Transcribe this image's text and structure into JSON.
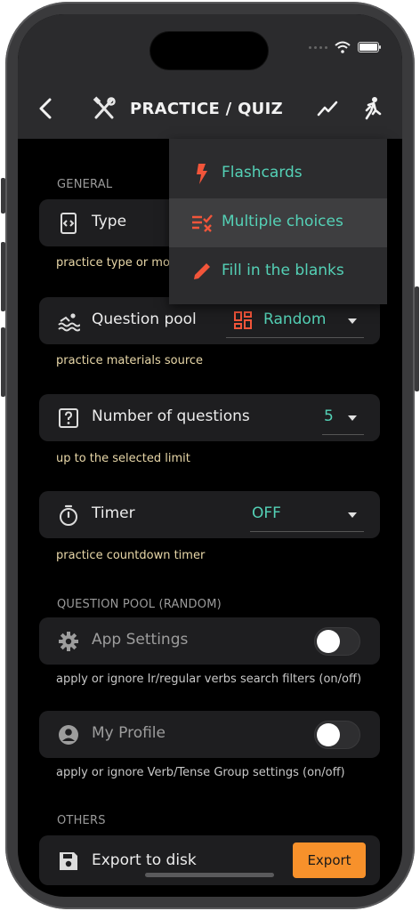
{
  "app_bar": {
    "title": "PRACTICE / QUIZ",
    "back_icon": "chevron-left-icon",
    "tools_icon": "tools-icon",
    "stats_icon": "trending-icon",
    "run_icon": "running-person-icon"
  },
  "dropdown_menu": {
    "items": [
      {
        "label": "Flashcards",
        "icon": "bolt-icon",
        "highlighted": false
      },
      {
        "label": "Multiple choices",
        "icon": "checklist-icon",
        "highlighted": true
      },
      {
        "label": "Fill in the blanks",
        "icon": "pencil-icon",
        "highlighted": false
      }
    ]
  },
  "sections": {
    "general": "GENERAL",
    "question_pool": "QUESTION POOL (RANDOM)",
    "others": "OTHERS"
  },
  "type_setting": {
    "label": "Type",
    "helper": "practice type or mo"
  },
  "question_pool_setting": {
    "label": "Question pool",
    "value": "Random",
    "helper": "practice materials source"
  },
  "number_setting": {
    "label": "Number of questions",
    "value": "5",
    "helper": "up to the selected limit"
  },
  "timer_setting": {
    "label": "Timer",
    "value": "OFF",
    "helper": "practice countdown timer"
  },
  "app_settings_toggle": {
    "label": "App Settings",
    "helper": "apply or ignore Ir/regular verbs search filters (on/off)",
    "on": false
  },
  "my_profile_toggle": {
    "label": "My Profile",
    "helper": "apply or ignore Verb/Tense Group settings (on/off)",
    "on": false
  },
  "export_setting": {
    "label": "Export to disk",
    "button": "Export"
  },
  "colors": {
    "accent_teal": "#54d1b6",
    "accent_orange": "#f7912b",
    "menu_icon_red": "#f2553a",
    "helper_text": "#e8d7a8",
    "background": "#000000",
    "card": "#1e1e20"
  }
}
